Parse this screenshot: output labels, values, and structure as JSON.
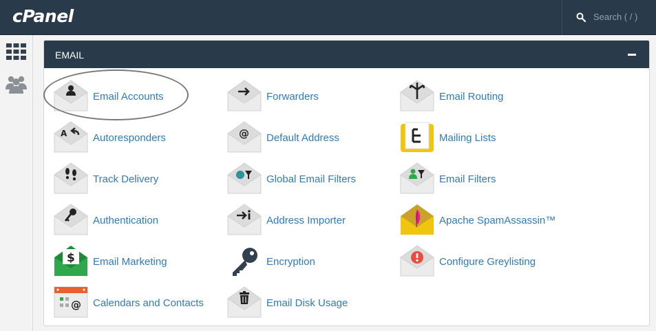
{
  "app": {
    "logo": "cPanel"
  },
  "search": {
    "placeholder": "Search ( / )"
  },
  "sidebar": {
    "icons": [
      "grid-icon",
      "users-icon"
    ]
  },
  "section": {
    "title": "EMAIL"
  },
  "items": [
    {
      "label": "Email Accounts"
    },
    {
      "label": "Forwarders"
    },
    {
      "label": "Email Routing"
    },
    {
      "label": "Autoresponders"
    },
    {
      "label": "Default Address"
    },
    {
      "label": "Mailing Lists"
    },
    {
      "label": "Track Delivery"
    },
    {
      "label": "Global Email Filters"
    },
    {
      "label": "Email Filters"
    },
    {
      "label": "Authentication"
    },
    {
      "label": "Address Importer"
    },
    {
      "label": "Apache SpamAssassin™"
    },
    {
      "label": "Email Marketing"
    },
    {
      "label": "Encryption"
    },
    {
      "label": "Configure Greylisting"
    },
    {
      "label": "Calendars and Contacts"
    },
    {
      "label": "Email Disk Usage"
    }
  ],
  "colors": {
    "header": "#293a4a",
    "link": "#2f7bb6",
    "green": "#2ea84a",
    "yellow": "#f1c40f",
    "red": "#e74c3c"
  }
}
